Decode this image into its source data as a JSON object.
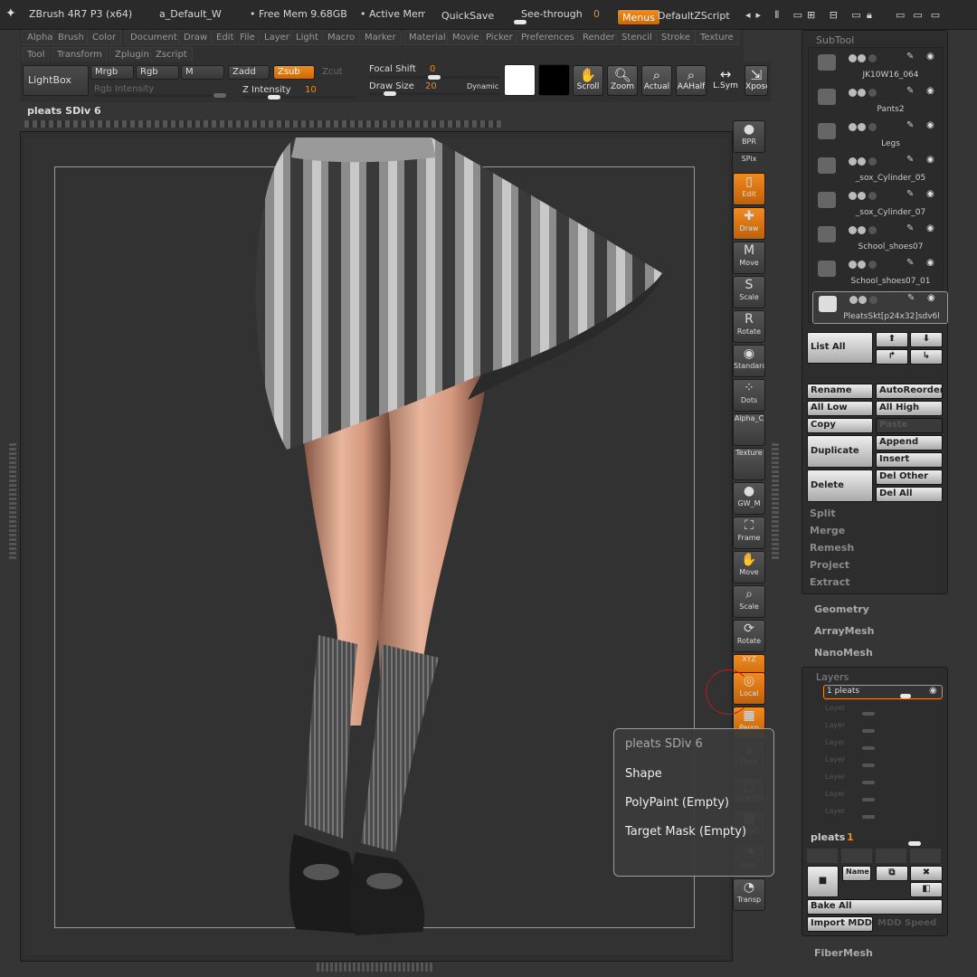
{
  "titlebar": {
    "app_title": "ZBrush 4R7 P3 (x64)",
    "doc_name": "a_Default_W",
    "free_mem": "• Free Mem 9.68GB",
    "active_mem": "• Active Mem",
    "quicksave": "QuickSave",
    "see_through_label": "See-through",
    "see_through_value": "0",
    "menus_label": "Menus",
    "script_name": "DefaultZScript"
  },
  "menus": [
    "Alpha",
    "Brush",
    "Color",
    "Document",
    "Draw",
    "Edit",
    "File",
    "Layer",
    "Light",
    "Macro",
    "Marker",
    "Material",
    "Movie",
    "Picker",
    "Preferences",
    "Render",
    "Stencil",
    "Stroke",
    "Texture",
    "Tool",
    "Transform",
    "Zplugin",
    "Zscript"
  ],
  "toolbar": {
    "lightbox": "LightBox",
    "mrgb": "Mrgb",
    "rgb": "Rgb",
    "m": "M",
    "zadd": "Zadd",
    "zsub": "Zsub",
    "zcut": "Zcut",
    "rgb_intensity": "Rgb Intensity",
    "z_intensity_label": "Z Intensity",
    "z_intensity_value": "10",
    "focal_shift_label": "Focal Shift",
    "focal_shift_value": "0",
    "draw_size_label": "Draw Size",
    "draw_size_value": "20",
    "dynamic": "Dynamic",
    "scroll": "Scroll",
    "zoom": "Zoom",
    "actual": "Actual",
    "aahalf": "AAHalf",
    "lsym": "L.Sym",
    "xpose": "Xpose"
  },
  "tool_status": "pleats SDiv 6",
  "shelf": [
    "BPR",
    "SPix",
    "Edit",
    "Draw",
    "Move",
    "Scale",
    "Rotate",
    "Standard",
    "Dots",
    "Alpha_C",
    "Texture",
    "GW_M",
    "Frame",
    "Move",
    "Scale",
    "Rotate",
    "XYZ",
    "Local",
    "Persp",
    "Floor",
    "Line Fill",
    "PolyF",
    "Solo",
    "Transp"
  ],
  "subtool": {
    "title": "SubTool",
    "items": [
      "JK10W16_064",
      "Pants2",
      "Legs",
      "_sox_Cylinder_05",
      "_sox_Cylinder_07",
      "School_shoes07",
      "School_shoes07_01",
      "PleatsSkt[p24x32]sdv6l"
    ],
    "buttons": {
      "list_all": "List All",
      "rename": "Rename",
      "autoreorder": "AutoReorder",
      "all_low": "All Low",
      "all_high": "All High",
      "copy": "Copy",
      "paste": "Paste",
      "duplicate": "Duplicate",
      "append": "Append",
      "insert": "Insert",
      "delete": "Delete",
      "del_other": "Del Other",
      "del_all": "Del All"
    },
    "sections": [
      "Split",
      "Merge",
      "Remesh",
      "Project",
      "Extract"
    ]
  },
  "palettes": [
    "Geometry",
    "ArrayMesh",
    "NanoMesh"
  ],
  "layers": {
    "title": "Layers",
    "active_layer": "1 pleats",
    "empty_layer": "Layer",
    "current_label": "pleats",
    "current_value": "1",
    "name_btn": "Name",
    "bake_all": "Bake All",
    "import_mdd": "Import MDD",
    "mdd_speed": "MDD Speed"
  },
  "fibermesh": "FiberMesh",
  "popup": {
    "title": "pleats SDiv 6",
    "items": [
      "Shape",
      "PolyPaint (Empty)",
      "Target Mask (Empty)"
    ]
  },
  "colors": {
    "accent": "#f08a1a",
    "background": "#353535"
  }
}
